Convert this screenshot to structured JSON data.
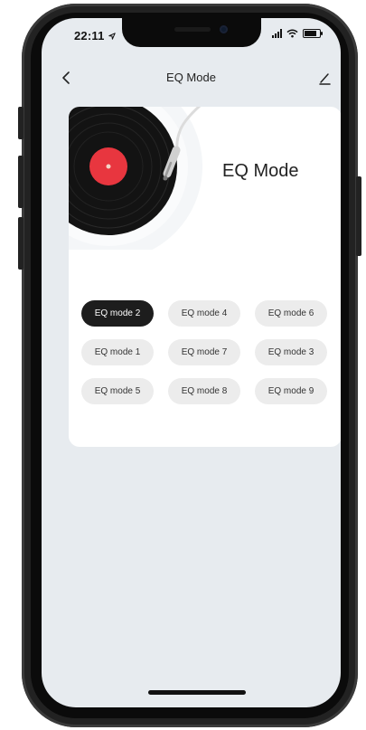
{
  "status": {
    "time": "22:11"
  },
  "nav": {
    "title": "EQ Mode"
  },
  "card": {
    "title": "EQ Mode"
  },
  "modes": [
    {
      "label": "EQ mode 2",
      "active": true
    },
    {
      "label": "EQ mode 4",
      "active": false
    },
    {
      "label": "EQ mode 6",
      "active": false
    },
    {
      "label": "EQ mode 1",
      "active": false
    },
    {
      "label": "EQ mode 7",
      "active": false
    },
    {
      "label": "EQ mode 3",
      "active": false
    },
    {
      "label": "EQ mode 5",
      "active": false
    },
    {
      "label": "EQ mode 8",
      "active": false
    },
    {
      "label": "EQ mode 9",
      "active": false
    }
  ],
  "colors": {
    "background": "#e7ebef",
    "card": "#ffffff",
    "pill": "#ececec",
    "pill_active": "#1d1d1d",
    "record_label": "#e8363f"
  },
  "icons": [
    "back-chevron-icon",
    "edit-pencil-icon",
    "location-arrow-icon",
    "signal-icon",
    "wifi-icon",
    "battery-icon",
    "vinyl-record-icon"
  ]
}
